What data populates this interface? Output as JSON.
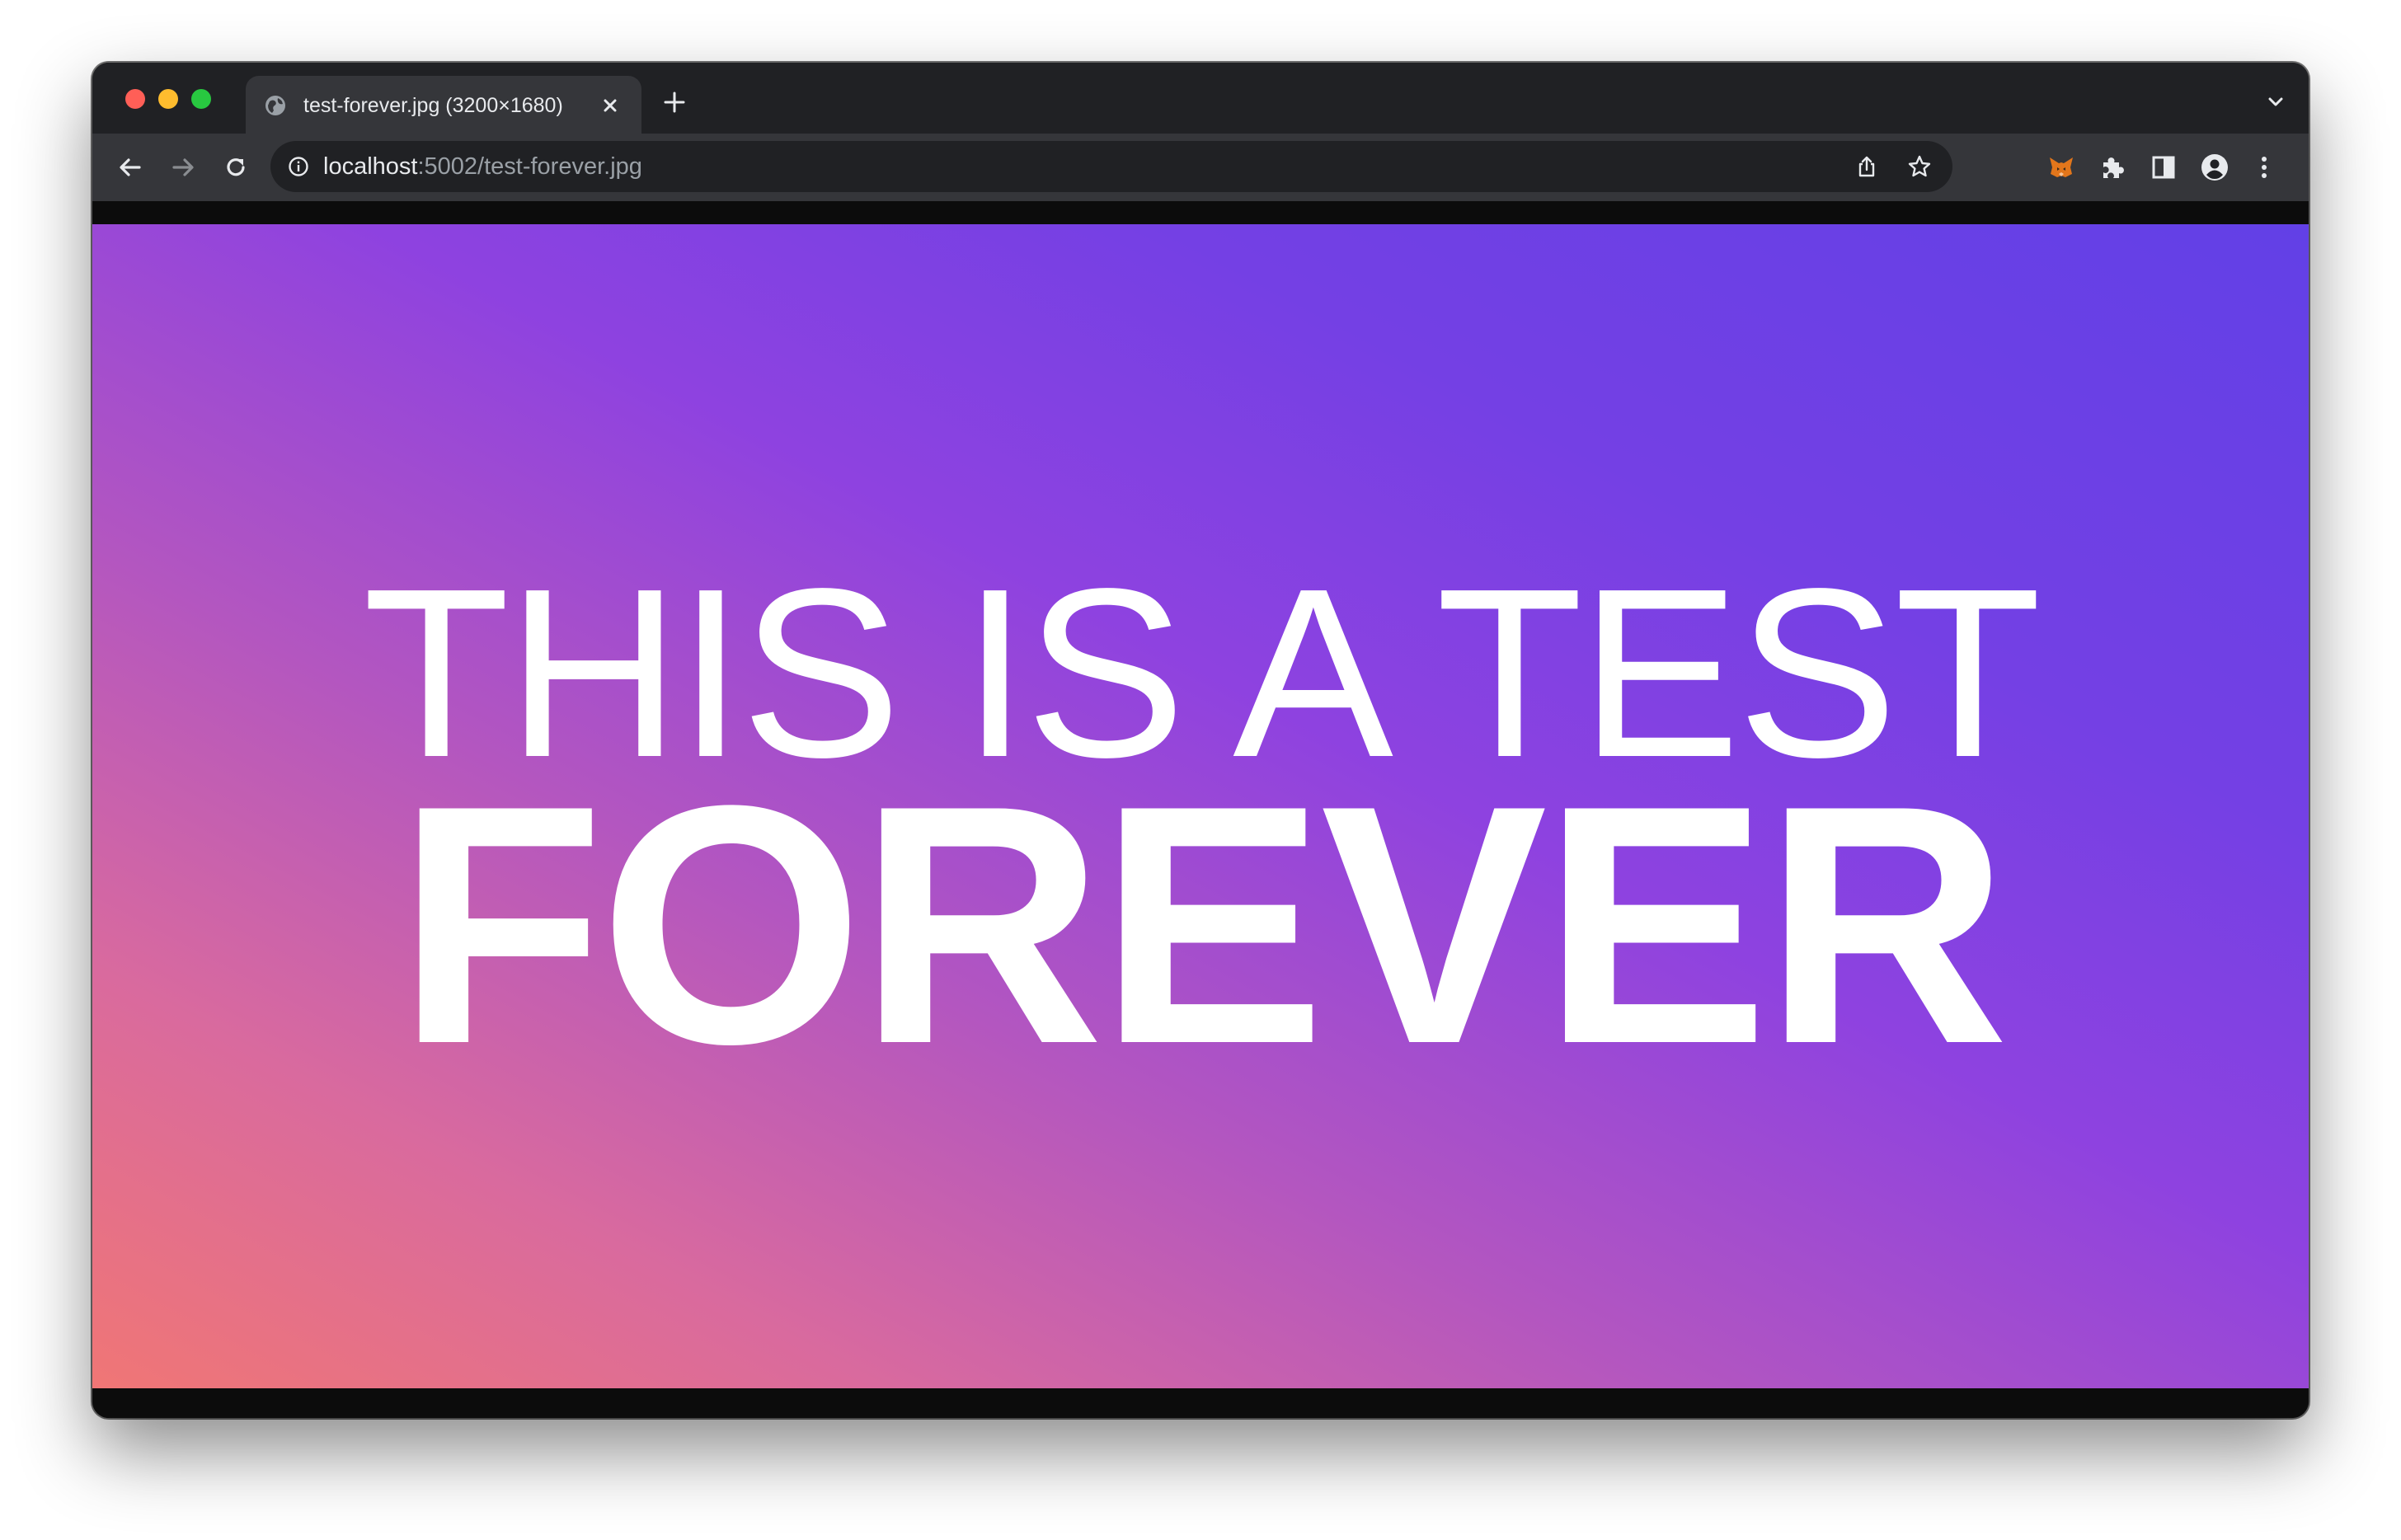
{
  "browser": {
    "tab": {
      "title": "test-forever.jpg (3200×1680)"
    },
    "address_bar": {
      "host": "localhost",
      "path": ":5002/test-forever.jpg"
    }
  },
  "image": {
    "line1": "THIS IS A TEST",
    "line2": "FOREVER"
  },
  "icons": {
    "window_controls": [
      "close-dot",
      "minimize-dot",
      "maximize-dot"
    ],
    "tab": [
      "globe-icon",
      "close-icon"
    ],
    "tabstrip": [
      "plus-icon",
      "chevron-down-icon"
    ],
    "toolbar": [
      "back-arrow-icon",
      "forward-arrow-icon",
      "reload-icon",
      "info-icon",
      "share-icon",
      "star-icon",
      "metamask-fox-icon",
      "puzzle-icon",
      "side-panel-icon",
      "profile-icon",
      "kebab-menu-icon"
    ]
  },
  "colors": {
    "tabstrip": "#202124",
    "toolbar": "#35363a",
    "omnibox": "#202124",
    "gradient_start": "#f07675",
    "gradient_mid": "#8e42e0",
    "gradient_end": "#6240e6",
    "close_dot": "#ff5f57",
    "minimize_dot": "#febc2e",
    "maximize_dot": "#28c840"
  }
}
